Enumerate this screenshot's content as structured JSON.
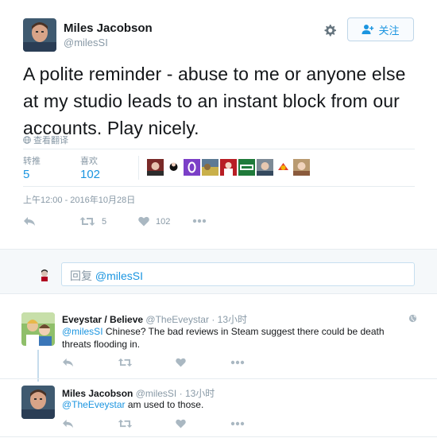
{
  "tweet": {
    "author_name": "Miles Jacobson",
    "author_handle": "@milesSI",
    "follow_label": "关注",
    "text": "A polite reminder - abuse to me or anyone else at my studio leads to an instant block from our accounts. Play nicely.",
    "translate_label": "查看翻译",
    "stats": {
      "retweets_label": "转推",
      "retweets_count": "5",
      "likes_label": "喜欢",
      "likes_count": "102"
    },
    "liker_avatars": [
      "liker-avatar-1",
      "liker-avatar-2",
      "liker-avatar-3",
      "liker-avatar-4",
      "liker-avatar-5",
      "liker-avatar-6",
      "liker-avatar-7",
      "liker-avatar-8",
      "liker-avatar-9"
    ],
    "timestamp": "上午12:00 - 2016年10月28日",
    "actions": {
      "retweet_count": "5",
      "like_count": "102"
    }
  },
  "reply_box": {
    "prefix": "回复 ",
    "mention": "@milesSI"
  },
  "replies": [
    {
      "name": "Eveystar / Believe",
      "handle": "@TheEveystar",
      "time": "13小时",
      "mention": "@milesSI",
      "text": " Chinese? The bad reviews in Steam suggest there could be death threats flooding in."
    },
    {
      "name": "Miles Jacobson",
      "handle": "@milesSI",
      "time": "13小时",
      "mention": "@TheEveystar",
      "text": " am used to those."
    }
  ],
  "colors": {
    "link_blue": "#1b95e0",
    "muted_gray": "#8899a6",
    "text_dark": "#14171a"
  }
}
